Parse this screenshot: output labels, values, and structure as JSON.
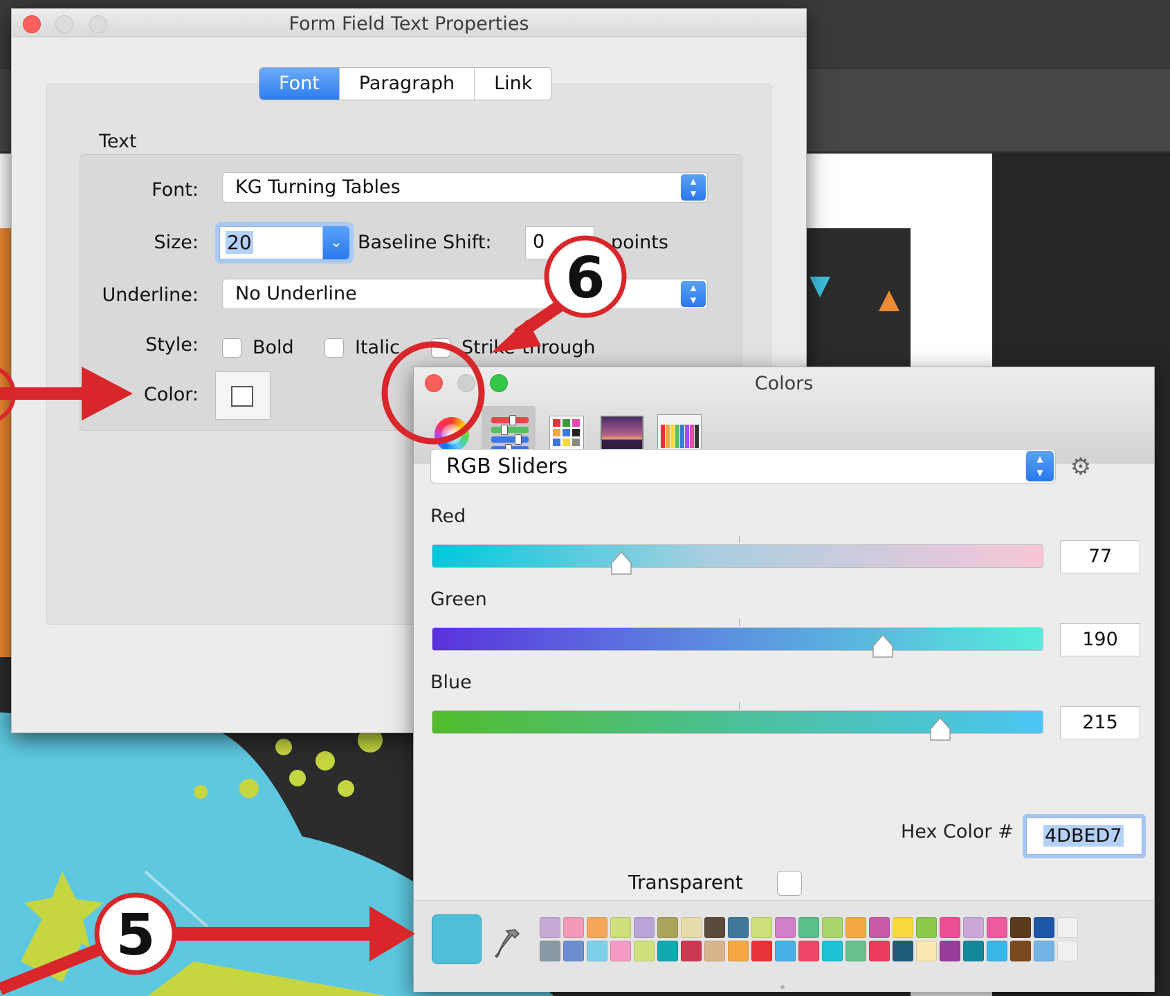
{
  "form_dialog": {
    "title": "Form Field Text Properties",
    "tabs": [
      {
        "label": "Font",
        "selected": true
      },
      {
        "label": "Paragraph",
        "selected": false
      },
      {
        "label": "Link",
        "selected": false
      }
    ],
    "section_label": "Text",
    "font": {
      "label": "Font:",
      "value": "KG Turning Tables"
    },
    "size": {
      "label": "Size:",
      "value": "20"
    },
    "baseline_shift": {
      "label": "Baseline Shift:",
      "value": "0",
      "unit": "points"
    },
    "underline": {
      "label": "Underline:",
      "value": "No Underline"
    },
    "style": {
      "label": "Style:",
      "bold": "Bold",
      "italic": "Italic",
      "strikethrough": "Strike-through"
    },
    "color": {
      "label": "Color:"
    }
  },
  "colors_panel": {
    "title": "Colors",
    "mode_buttons": [
      "color-wheel-icon",
      "color-sliders-icon",
      "color-palettes-icon",
      "image-palettes-icon",
      "pencils-icon"
    ],
    "selected_mode": "color-sliders-icon",
    "slider_mode": "RGB Sliders",
    "channels": [
      {
        "label": "Red",
        "value": "77",
        "level": 77
      },
      {
        "label": "Green",
        "value": "190",
        "level": 190
      },
      {
        "label": "Blue",
        "value": "215",
        "level": 215
      }
    ],
    "hex_label": "Hex Color #",
    "hex_value": "4DBED7",
    "transparent_label": "Transparent",
    "current_color": "#4DBED7",
    "swatches": [
      "#c7a8d6",
      "#f29ab8",
      "#f5a85a",
      "#cde07a",
      "#b9a4d8",
      "#a8a45a",
      "#e6dcaa",
      "#5c4a3c",
      "#3f7898",
      "#cde07a",
      "#cf7fc6",
      "#58c08a",
      "#a9d66a",
      "#f5a844",
      "#c85aa8",
      "#f8d83a",
      "#8cc84a",
      "#ec4f94",
      "#c9a8d8",
      "#ec5aa0",
      "#5c3a1e",
      "#1e56a8",
      "#f0f0f0",
      "#8a9aa4",
      "#6a8ed0",
      "#7dd0e8",
      "#f49ac4",
      "#cde07a",
      "#12a8b0",
      "#cc3852",
      "#d8b48c",
      "#f5a844",
      "#e8323a",
      "#46b0e8",
      "#ee4468",
      "#20c0d8",
      "#68c08a",
      "#ec3c5c",
      "#1e5c7a",
      "#f8e8b0",
      "#9a3c9a",
      "#12889a",
      "#38b8e8",
      "#7a4a1e",
      "#74b4e4",
      "#f0f0f0"
    ]
  },
  "annotations": {
    "five": "5",
    "six": "6",
    "arrow_color": "#d9262a"
  }
}
